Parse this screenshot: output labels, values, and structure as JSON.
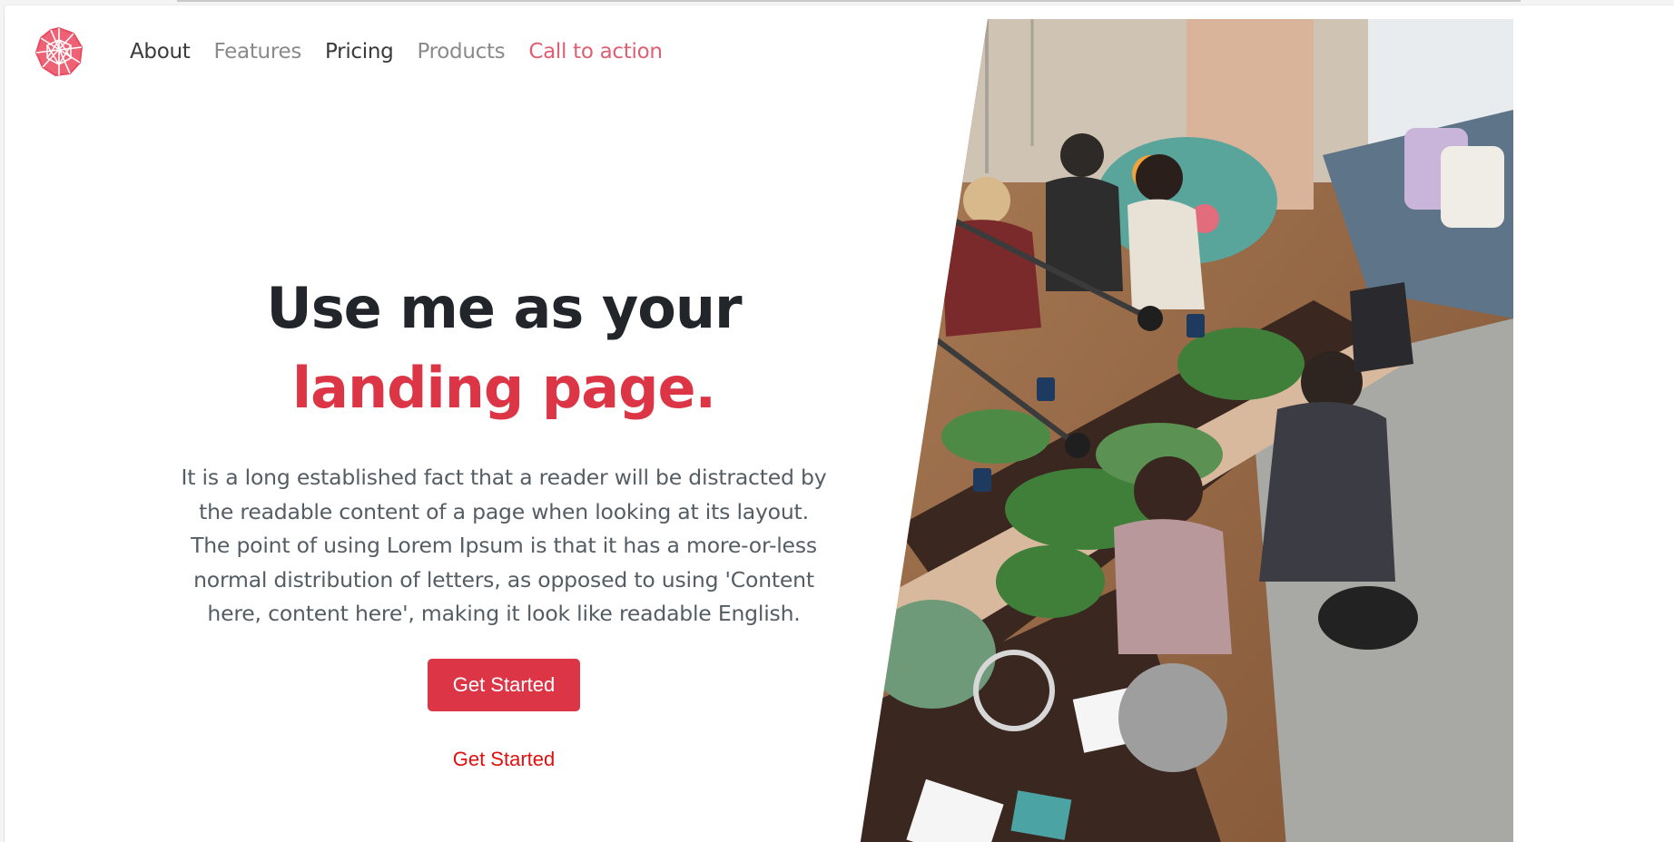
{
  "brand": {
    "logo_icon": "red-geometric-logo-icon",
    "accent_color": "#dc3545"
  },
  "nav": {
    "items": [
      {
        "label": "About"
      },
      {
        "label": "Features"
      },
      {
        "label": "Pricing"
      },
      {
        "label": "Products"
      },
      {
        "label": "Call to action"
      }
    ]
  },
  "hero": {
    "title_line1": "Use me as your",
    "title_line2": "landing page.",
    "body": "It is a long established fact that a reader will be distracted by the readable content of a page when looking at its layout. The point of using Lorem Ipsum is that it has a more-or-less normal distribution of letters, as opposed to using 'Content here, content here', making it look like readable English.",
    "primary_button": "Get Started",
    "secondary_link": "Get Started"
  },
  "image": {
    "icon": "workshop-photo"
  }
}
